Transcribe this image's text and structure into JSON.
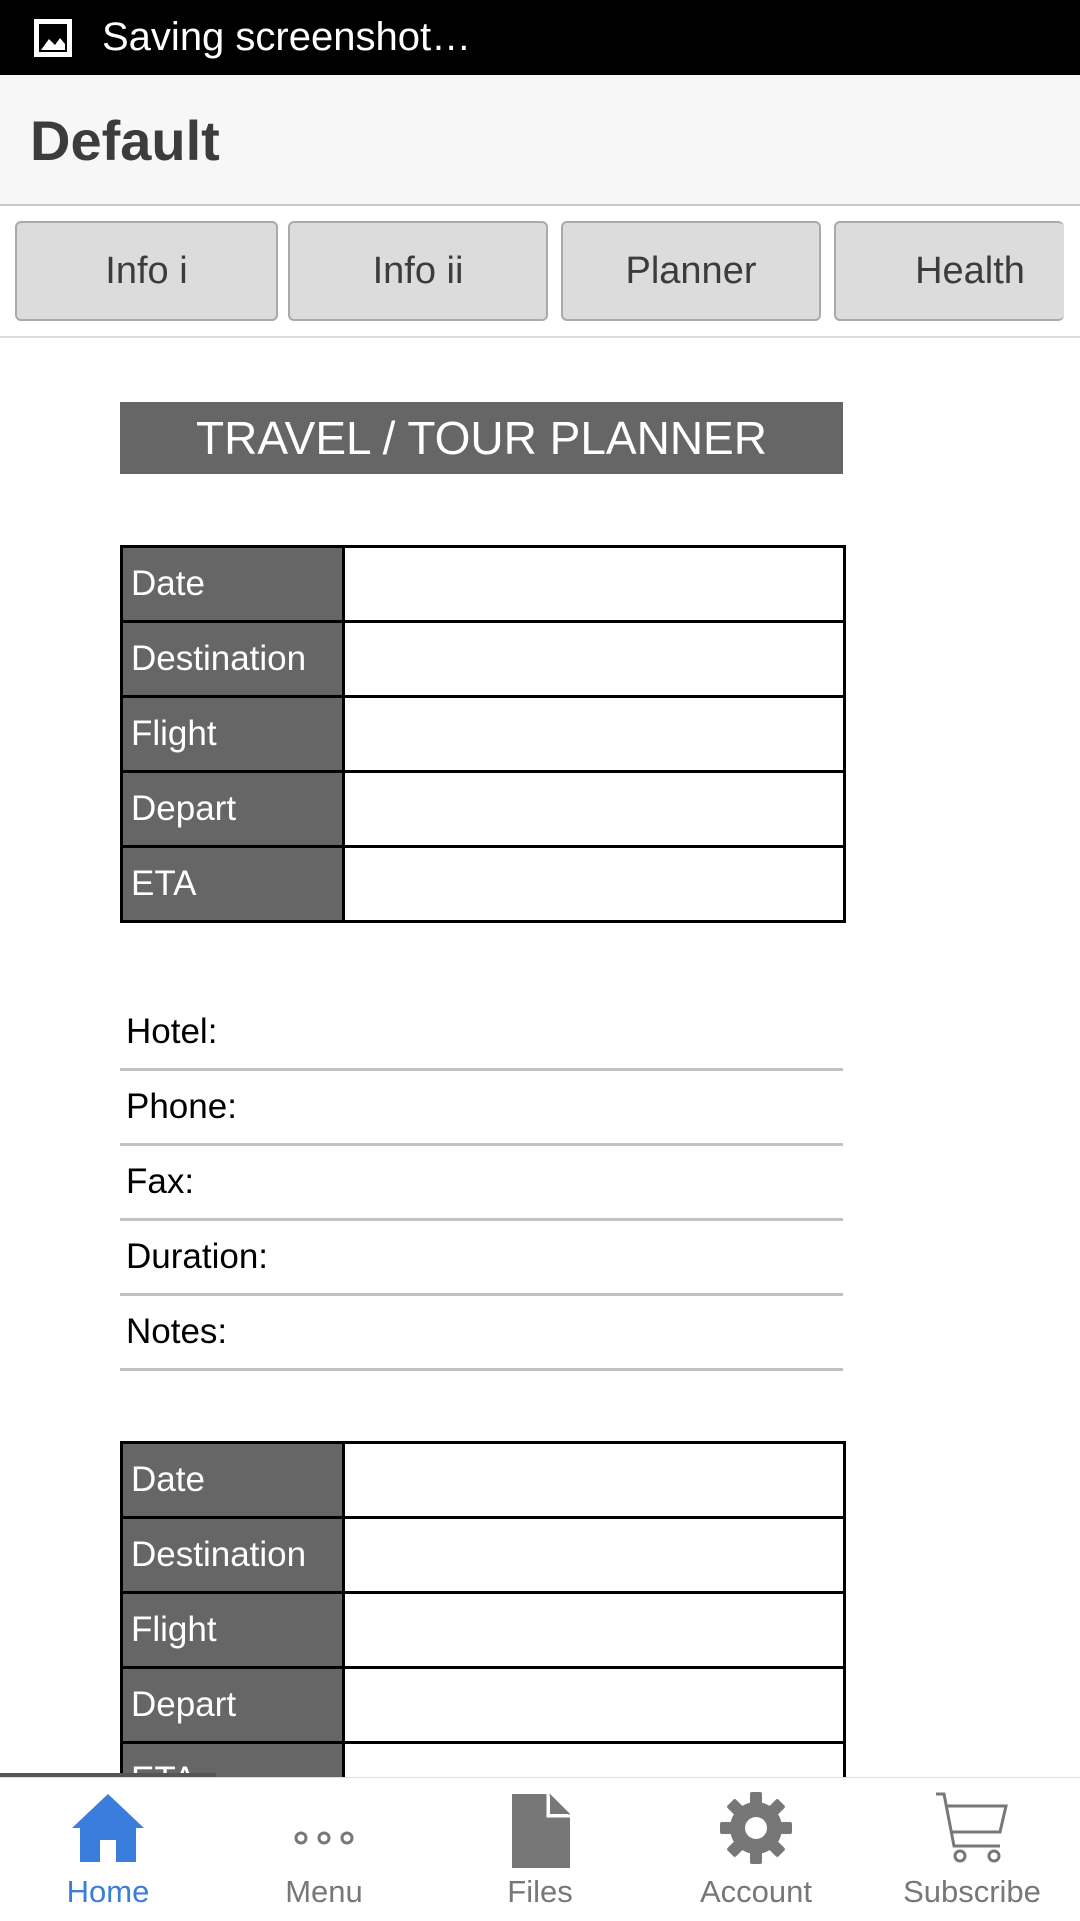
{
  "status_bar": {
    "text": "Saving screenshot…"
  },
  "app_bar": {
    "title": "Default"
  },
  "tabs": [
    {
      "label": "Info i"
    },
    {
      "label": "Info ii"
    },
    {
      "label": "Planner"
    },
    {
      "label": "Health"
    }
  ],
  "planner": {
    "title": "TRAVEL / TOUR PLANNER",
    "table1": [
      {
        "label": "Date",
        "value": ""
      },
      {
        "label": "Destination",
        "value": ""
      },
      {
        "label": "Flight",
        "value": ""
      },
      {
        "label": "Depart",
        "value": ""
      },
      {
        "label": "ETA",
        "value": ""
      }
    ],
    "details": [
      {
        "label": "Hotel:"
      },
      {
        "label": "Phone:"
      },
      {
        "label": "Fax:"
      },
      {
        "label": "Duration:"
      },
      {
        "label": "Notes:"
      }
    ],
    "table2": [
      {
        "label": "Date",
        "value": ""
      },
      {
        "label": "Destination",
        "value": ""
      },
      {
        "label": "Flight",
        "value": ""
      },
      {
        "label": "Depart",
        "value": ""
      },
      {
        "label": "ETA",
        "value": ""
      }
    ]
  },
  "bottom_nav": [
    {
      "label": "Home",
      "icon": "home-icon",
      "active": true
    },
    {
      "label": "Menu",
      "icon": "more-dots-icon",
      "active": false
    },
    {
      "label": "Files",
      "icon": "file-icon",
      "active": false
    },
    {
      "label": "Account",
      "icon": "gear-icon",
      "active": false
    },
    {
      "label": "Subscribe",
      "icon": "cart-icon",
      "active": false
    }
  ],
  "colors": {
    "active_nav": "#3b7ddd",
    "inactive_nav": "#777777",
    "label_cell_bg": "#666666"
  }
}
